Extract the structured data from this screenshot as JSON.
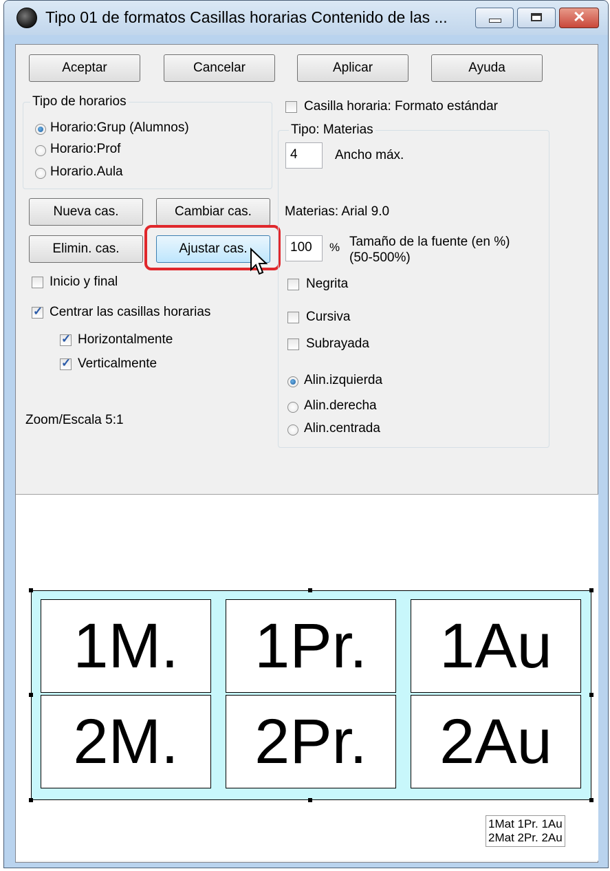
{
  "window": {
    "title": "Tipo 01 de formatos  Casillas horarias  Contenido de las ..."
  },
  "buttons": {
    "aceptar": "Aceptar",
    "cancelar": "Cancelar",
    "aplicar": "Aplicar",
    "ayuda": "Ayuda",
    "nueva": "Nueva cas.",
    "cambiar": "Cambiar cas.",
    "eliminar": "Elimin. cas.",
    "ajustar": "Ajustar cas."
  },
  "tipo_horarios": {
    "legend": "Tipo de horarios",
    "options": [
      {
        "label": "Horario:Grup (Alumnos)",
        "selected": true
      },
      {
        "label": "Horario:Prof",
        "selected": false
      },
      {
        "label": "Horario.Aula",
        "selected": false
      }
    ]
  },
  "checks_left": {
    "inicio_final": {
      "label": "Inicio y final",
      "checked": false
    },
    "centrar": {
      "label": "Centrar las casillas horarias",
      "checked": true
    },
    "horizontal": {
      "label": "Horizontalmente",
      "checked": true
    },
    "vertical": {
      "label": "Verticalmente",
      "checked": true
    }
  },
  "zoom": "Zoom/Escala  5:1",
  "formato_estandar": {
    "label": "Casilla horaria: Formato estándar",
    "checked": false
  },
  "tipo_group": {
    "legend": "Tipo: Materias",
    "ancho_value": "4",
    "ancho_label": "Ancho máx.",
    "font_info": "Materias: Arial 9.0",
    "size_value": "100",
    "percent_sign": "%",
    "size_label_1": "Tamaño de la fuente (en %)",
    "size_label_2": "(50-500%)",
    "negrita": {
      "label": "Negrita",
      "checked": false
    },
    "cursiva": {
      "label": "Cursiva",
      "checked": false
    },
    "subrayada": {
      "label": "Subrayada",
      "checked": false
    },
    "align": [
      {
        "label": "Alin.izquierda",
        "selected": true
      },
      {
        "label": "Alin.derecha",
        "selected": false
      },
      {
        "label": "Alin.centrada",
        "selected": false
      }
    ]
  },
  "preview": {
    "cells": [
      "1M.",
      "1Pr.",
      "1Au",
      "2M.",
      "2Pr.",
      "2Au"
    ],
    "legend_line1": "1Mat 1Pr.  1Au",
    "legend_line2": "2Mat 2Pr.  2Au",
    "colors": {
      "frame_bg": "#c8f7fb",
      "highlight": "#e0282c"
    }
  }
}
